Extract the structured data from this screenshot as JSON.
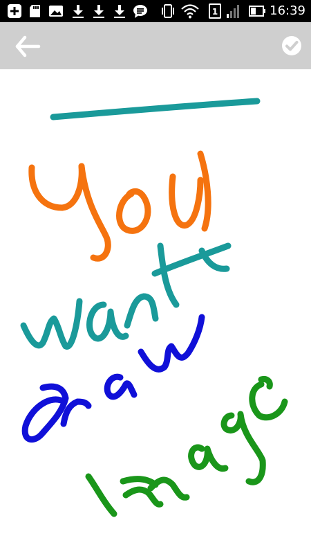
{
  "status_bar": {
    "time": "16:39",
    "battery_label": "1",
    "icons": [
      "add-notification-icon",
      "sd-card-icon",
      "image-icon",
      "download-icon",
      "download-icon",
      "download-icon",
      "chat-icon",
      "vibrate-icon",
      "wifi-icon",
      "sim-1-icon",
      "signal-icon",
      "battery-icon"
    ]
  },
  "toolbar": {
    "back_icon": "arrow-left-icon",
    "done_icon": "check-circle-icon",
    "background": "#cfcfcf"
  },
  "drawing": {
    "strokes": [
      {
        "word": "",
        "color": "#1a9a9a",
        "desc": "line"
      },
      {
        "word": "You",
        "color": "#f5730f"
      },
      {
        "word": "want",
        "color": "#1a9a9a"
      },
      {
        "word": "draw",
        "color": "#1010d8"
      },
      {
        "word": "Image",
        "color": "#1a961a"
      }
    ]
  }
}
